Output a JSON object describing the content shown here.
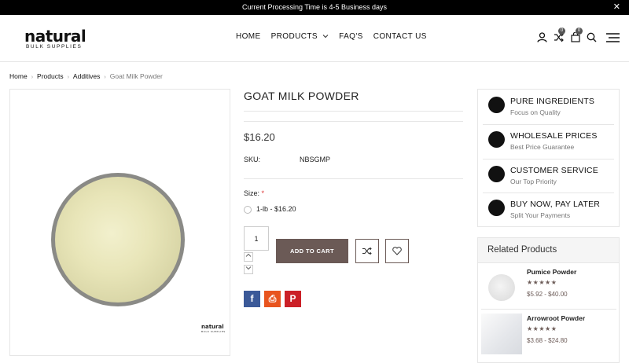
{
  "topbar": {
    "message": "Current Processing Time is 4-5 Business days",
    "close": "✕"
  },
  "logo": {
    "line1": "natural",
    "line2": "BULK SUPPLIES"
  },
  "nav": {
    "home": "HOME",
    "products": "PRODUCTS",
    "faqs": "FAQ'S",
    "contact": "CONTACT US"
  },
  "header_icons": {
    "compare_count": "0",
    "cart_count": "0"
  },
  "breadcrumb": {
    "home": "Home",
    "products": "Products",
    "category": "Additives",
    "current": "Goat Milk Powder"
  },
  "product": {
    "title": "GOAT MILK POWDER",
    "price": "$16.20",
    "sku_label": "SKU:",
    "sku_value": "NBSGMP",
    "size_label": "Size:",
    "size_required": "*",
    "size_option": "1-lb - $16.20",
    "quantity": "1",
    "add_to_cart": "ADD TO CART",
    "watermark_main": "natural",
    "watermark_sub": "BULK SUPPLIES"
  },
  "share": {
    "facebook": "f",
    "print": "⎙",
    "pinterest": "P"
  },
  "features": [
    {
      "title": "PURE INGREDIENTS",
      "subtitle": "Focus on Quality"
    },
    {
      "title": "WHOLESALE PRICES",
      "subtitle": "Best Price Guarantee"
    },
    {
      "title": "CUSTOMER SERVICE",
      "subtitle": "Our Top Priority"
    },
    {
      "title": "BUY NOW, PAY LATER",
      "subtitle": "Split Your Payments"
    }
  ],
  "related": {
    "heading": "Related Products",
    "items": [
      {
        "name": "Pumice Powder",
        "stars": "★★★★★",
        "price": "$5.92 - $40.00"
      },
      {
        "name": "Arrowroot Powder",
        "stars": "★★★★★",
        "price": "$3.68 - $24.80"
      }
    ]
  },
  "colors": {
    "accent": "#6b5a56",
    "facebook": "#3b5998",
    "print": "#e8541e",
    "pinterest": "#cb2027"
  }
}
